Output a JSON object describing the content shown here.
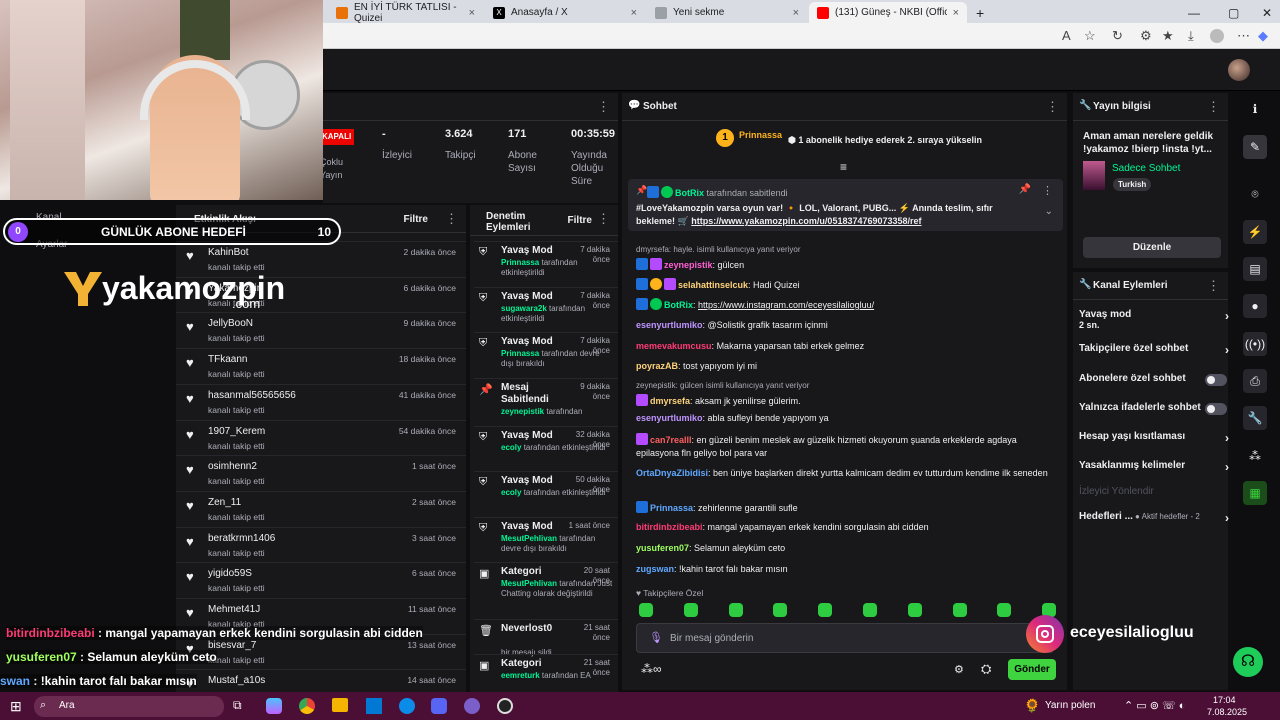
{
  "browser": {
    "tabs": [
      {
        "title": "EN İYİ TÜRK TATLISI - Quizei",
        "color": "#e8710a"
      },
      {
        "title": "Anasayfa / X",
        "color": "#000000"
      },
      {
        "title": "Yeni sekme",
        "color": "#9aa0a6"
      },
      {
        "title": "(131) Güneş - NKBİ (Official Musi",
        "color": "#ff0000"
      }
    ],
    "new_tab": "+",
    "address_icons": [
      "read-aloud-icon",
      "star-icon",
      "extensions-icon",
      "favorites-icon",
      "download-icon",
      "profile-icon",
      "more-icon",
      "copilot-icon"
    ]
  },
  "stream_manager": {
    "stats": [
      {
        "value": "-",
        "label": "İzleyici"
      },
      {
        "value": "3.624",
        "label": "Takipçi"
      },
      {
        "value": "171",
        "label": "Abone Sayısı"
      },
      {
        "value": "00:35:59",
        "label": "Yayında Olduğu Süre"
      }
    ],
    "status_badge": "KAPALI",
    "status_label": "Çoklu Yayın",
    "quick_actions": {
      "label": "Kanal",
      "label2": "Ayarlar"
    }
  },
  "activity_feed": {
    "title": "Etkinlik Akışı",
    "filter": "Filtre",
    "items": [
      {
        "name": "KahinBot",
        "action": "kanalı takip etti",
        "time": "2 dakika önce"
      },
      {
        "name": "Yakamozpin",
        "action": "kanalı takip etti",
        "time": "6 dakika önce"
      },
      {
        "name": "JellyBooN",
        "action": "kanalı takip etti",
        "time": "9 dakika önce"
      },
      {
        "name": "TFkaann",
        "action": "kanalı takip etti",
        "time": "18 dakika önce"
      },
      {
        "name": "hasanmal56565656",
        "action": "kanalı takip etti",
        "time": "41 dakika önce"
      },
      {
        "name": "1907_Kerem",
        "action": "kanalı takip etti",
        "time": "54 dakika önce"
      },
      {
        "name": "osimhenn2",
        "action": "kanalı takip etti",
        "time": "1 saat önce"
      },
      {
        "name": "Zen_11",
        "action": "kanalı takip etti",
        "time": "2 saat önce"
      },
      {
        "name": "beratkrmn1406",
        "action": "kanalı takip etti",
        "time": "3 saat önce"
      },
      {
        "name": "yigido59S",
        "action": "kanalı takip etti",
        "time": "6 saat önce"
      },
      {
        "name": "Mehmet41J",
        "action": "kanalı takip etti",
        "time": "11 saat önce"
      },
      {
        "name": "bisesvar_7",
        "action": "kanalı takip etti",
        "time": "13 saat önce"
      },
      {
        "name": "Mustaf_a10s",
        "action": "",
        "time": "14 saat önce"
      }
    ]
  },
  "mod_actions": {
    "title": "Denetim Eylemleri",
    "filter": "Filtre",
    "items": [
      {
        "icon": "mod-icon",
        "name": "Yavaş Mod",
        "time": "7 dakika önce",
        "user": "Prinnassa",
        "desc": "tarafından etkinleştirildi"
      },
      {
        "icon": "mod-icon",
        "name": "Yavaş Mod",
        "time": "7 dakika önce",
        "user": "sugawara2k",
        "desc": "tarafından etkinleştirildi"
      },
      {
        "icon": "mod-icon",
        "name": "Yavaş Mod",
        "time": "7 dakika önce",
        "user": "Prinnassa",
        "desc": "tarafından devre dışı bırakıldı"
      },
      {
        "icon": "pin-icon",
        "name": "Mesaj Sabitlendi",
        "time": "9 dakika önce",
        "user": "zeynepistik",
        "desc": "tarafından"
      },
      {
        "icon": "mod-icon",
        "name": "Yavaş Mod",
        "time": "32 dakika önce",
        "user": "ecoly",
        "desc": "tarafından etkinleştirildi"
      },
      {
        "icon": "mod-icon",
        "name": "Yavaş Mod",
        "time": "50 dakika önce",
        "user": "ecoly",
        "desc": "tarafından etkinleştirildi"
      },
      {
        "icon": "mod-icon",
        "name": "Yavaş Mod",
        "time": "1 saat önce",
        "user": "MesutPehlivan",
        "desc": "tarafından devre dışı bırakıldı"
      },
      {
        "icon": "category-icon",
        "name": "Kategori",
        "time": "20 saat önce",
        "user": "MesutPehlivan",
        "desc": "tarafından Just Chatting olarak değiştirildi"
      },
      {
        "icon": "trash-icon",
        "name": "Neverlost0",
        "time": "21 saat önce",
        "user": "",
        "desc": "bir mesajı sildi"
      },
      {
        "icon": "category-icon",
        "name": "Kategori",
        "time": "21 saat önce",
        "user": "eemreturk",
        "desc": "tarafından EA"
      }
    ]
  },
  "chat": {
    "title": "Sohbet",
    "gift_user": "Prinnassa",
    "gift_count": "1",
    "gift_text": "1 abonelik hediye ederek 2. sıraya yükselin",
    "pinned": {
      "by": "BotRix",
      "by_suffix": "tarafından sabitlendi",
      "text": "#LoveYakamozpin varsa oyun var! 🔸 LOL, Valorant, PUBG... ⚡ Anında teslim, sıfır bekleme! 🛒",
      "link": "https://www.yakamozpin.com/u/0518374769073358/ref"
    },
    "messages": [
      {
        "reply": "dmyrsefa: hayle. isimli kullanıcıya yanıt veriyor",
        "user": "zeynepistik",
        "color": "#ff5fd2",
        "text": "gülcen"
      },
      {
        "user": "selahattinselcuk",
        "color": "#ffd37a",
        "text": "Hadi Quizei"
      },
      {
        "user": "BotRix",
        "color": "#00f593",
        "text": "",
        "link": "https://www.instagram.com/eceyesilaliogluu/"
      },
      {
        "user": "esenyurtlumiko",
        "color": "#bf94ff",
        "text": "@Solistik grafik tasarım içinmi"
      },
      {
        "user": "memevakumcusu",
        "color": "#ff3b75",
        "text": "Makarna yaparsan tabi erkek gelmez"
      },
      {
        "user": "poyrazAB",
        "color": "#ffd37a",
        "text": "tost yapıyom iyi mi"
      },
      {
        "reply": "zeynepistik: gülcen isimli kullanıcıya yanıt veriyor",
        "user": "dmyrsefa",
        "color": "#ffd37a",
        "text": "aksam jk yenilirse gülerim."
      },
      {
        "user": "esenyurtlumiko",
        "color": "#bf94ff",
        "text": "abla sufleyi bende yapıyom ya"
      },
      {
        "user": "can7realll",
        "color": "#ff5f5f",
        "text": "en güzeli benim meslek aw güzelik hizmeti okuyorum şuanda erkeklerde agdaya epilasyona fln geliyo bol para var"
      },
      {
        "user": "OrtaDnyaZibidisi",
        "color": "#5fa8ff",
        "text": "ben üniye başlarken direkt yurtta kalmicam dedim ev tutturdum kendime ilk seneden"
      },
      {
        "user": "Prinnassa",
        "color": "#5fa8ff",
        "text": "zehirlenme garantili sufle"
      },
      {
        "user": "bitirdinbzibeabi",
        "color": "#ff3b75",
        "text": "mangal yapamayan erkek kendini sorgulasin abi cidden"
      },
      {
        "user": "yusuferen07",
        "color": "#9fff5f",
        "text": "Selamun aleyküm ceto"
      },
      {
        "user": "zugswan",
        "color": "#5fa8ff",
        "text": "!kahin tarot falı bakar mısın"
      }
    ],
    "follower_only": "Takipçilere Özel",
    "input_placeholder": "Bir mesaj gönderin",
    "send_button": "Gönder"
  },
  "stream_info": {
    "title": "Yayın bilgisi",
    "stream_title": "Aman aman nerelere geldik !yakamoz !bierp !insta !yt...",
    "category": "Sadece Sohbet",
    "tag": "Turkish",
    "edit_button": "Düzenle"
  },
  "channel_actions": {
    "title": "Kanal Eylemleri",
    "items": [
      {
        "label": "Yavaş mod",
        "sub": "2 sn.",
        "kind": "chevron"
      },
      {
        "label": "Takipçilere özel sohbet",
        "kind": "chevron"
      },
      {
        "label": "Abonelere özel sohbet",
        "kind": "toggle"
      },
      {
        "label": "Yalnızca ifadelerle sohbet",
        "kind": "toggle"
      },
      {
        "label": "Hesap yaşı kısıtlaması",
        "kind": "chevron"
      },
      {
        "label": "Yasaklanmış kelimeler",
        "kind": "chevron"
      },
      {
        "label": "İzleyici Yönlendir",
        "kind": "disabled"
      },
      {
        "label": "Hedefleri ...",
        "sub": "● Aktif hedefler - 2",
        "kind": "chevron"
      }
    ]
  },
  "overlay": {
    "goal_count": "0",
    "goal_title": "GÜNLÜK ABONE HEDEFİ",
    "goal_target": "10",
    "brand": "yakamozpin",
    "brand_sub": ".com",
    "instagram": "eceyesilaliogluu",
    "chat_lines": [
      {
        "user": "bitirdinbzibeabi",
        "color": "#ff3b75",
        "text": "mangal yapamayan erkek kendini sorgulasin abi cidden"
      },
      {
        "user": "yusuferen07",
        "color": "#9fff5f",
        "text": "Selamun aleyküm ceto"
      },
      {
        "user": "swan",
        "color": "#5fa8ff",
        "text": "!kahin tarot falı bakar mısın"
      }
    ]
  },
  "taskbar": {
    "search": "Ara",
    "weather": "Yarın polen",
    "time": "17:04",
    "date": "7.08.2025"
  }
}
